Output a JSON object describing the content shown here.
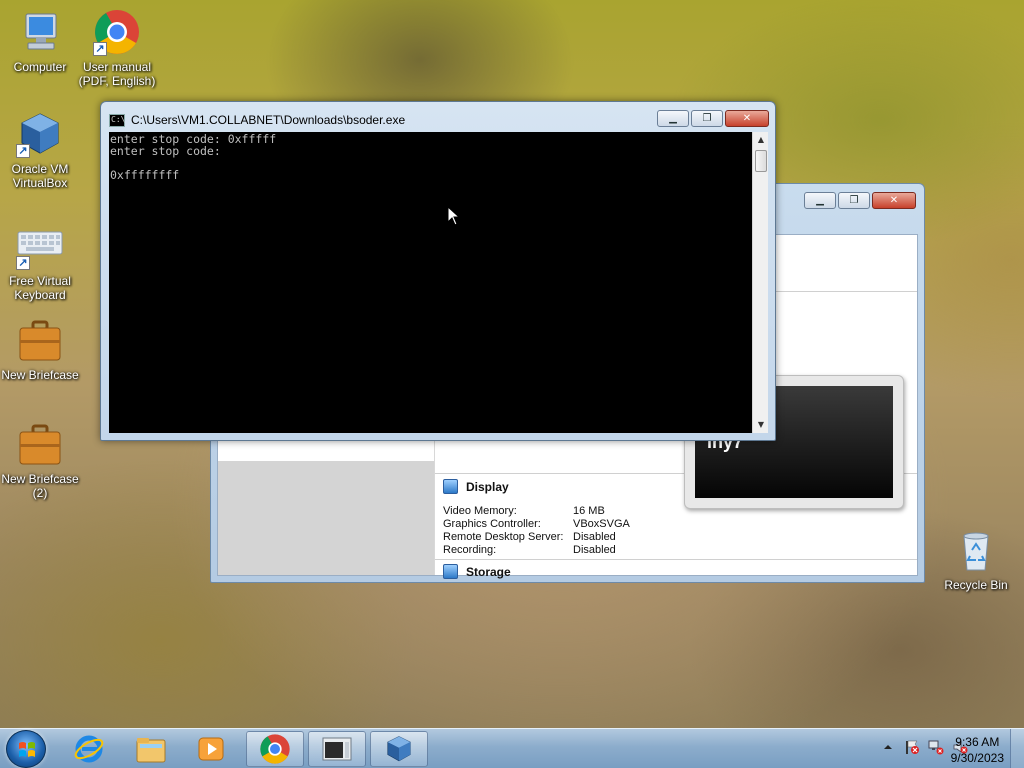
{
  "desktop": {
    "icons": [
      {
        "label": "Computer"
      },
      {
        "label": "User manual\n(PDF, English)"
      },
      {
        "label": "Oracle VM\nVirtualBox"
      },
      {
        "label": "Free Virtual\nKeyboard"
      },
      {
        "label": "New Briefcase"
      },
      {
        "label": "New Briefcase\n(2)"
      },
      {
        "label": "Recycle Bin"
      }
    ]
  },
  "console": {
    "title": "C:\\Users\\VM1.COLLABNET\\Downloads\\bsoder.exe",
    "output": "enter stop code: 0xfffff\nenter stop code:\n\n0xffffffff",
    "buttons": {
      "minimize": "▁",
      "maximize": "❐",
      "close": "✕"
    }
  },
  "virtualbox": {
    "buttons": {
      "minimize": "▁",
      "maximize": "❐",
      "close": "✕"
    },
    "preview_text": "iny7",
    "display": {
      "heading": "Display",
      "rows": [
        {
          "key": "Video Memory:",
          "value": "16 MB"
        },
        {
          "key": "Graphics Controller:",
          "value": "VBoxSVGA"
        },
        {
          "key": "Remote Desktop Server:",
          "value": "Disabled"
        },
        {
          "key": "Recording:",
          "value": "Disabled"
        }
      ]
    },
    "storage": {
      "heading": "Storage"
    }
  },
  "taskbar": {
    "apps": [
      "start-orb",
      "internet-explorer-icon",
      "windows-explorer-icon",
      "media-player-icon",
      "chrome-icon",
      "console-app-icon",
      "virtualbox-icon"
    ],
    "clock": {
      "time": "9:36 AM",
      "date": "9/30/2023"
    }
  },
  "colors": {
    "console_bg": "#000000",
    "console_fg": "#c0c0c0",
    "close_button": "#c7402b",
    "taskbar": "#8cb0d6"
  }
}
